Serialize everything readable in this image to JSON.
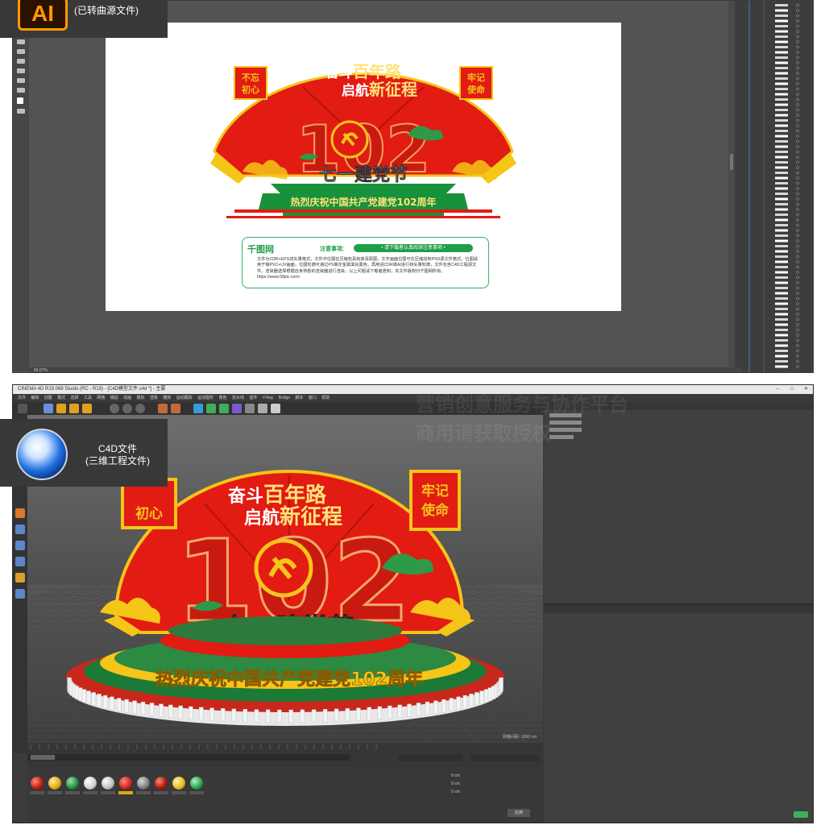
{
  "ai_badge": {
    "logo_text": "AI",
    "caption": "(已转曲源文件)"
  },
  "c4d_badge": {
    "title": "C4D文件",
    "subtitle": "(三维工程文件)"
  },
  "artwork": {
    "slogan_line1_a": "奋斗",
    "slogan_line1_b": "百年路",
    "slogan_line2_a": "启航",
    "slogan_line2_b": "新征程",
    "left_tag": "不忘初心",
    "right_tag": "牢记使命",
    "number": "102",
    "festival": "七一建党节",
    "banner": "热烈庆祝中国共产党建党102周年"
  },
  "notice": {
    "brand": "千图网",
    "title": "注意事项:",
    "pill": "• 请下载者认真阅读注意事项 •",
    "body": "文件为CDR+EPS双矢量格式，文件中位图在压缩包具有高清原图，文字画面位图可在压缩找到PSD源文件格式，位图适用于做PVC+UV画面，位图轮廓可通过PS做定金属填充黑色，再用进CDR或AI进行转矢量轮廓，文件包含C4D工程源文件，渲染器选择根据自身熟悉的渲染器进行渲染，以上问题请下载者悉知，本文件版权归千图网所有，https://www.58pic.com/"
  },
  "c4d": {
    "window_title": "CINEMA 4D R19.068 Studio (RC - R19) - [C4D模型文件.c4d *] - 主要",
    "menu": "文件 编辑 创建 模式 选择 工具 网格 捕捉 动画 模拟 渲染 雕刻 运动跟踪 运动图形 角色 流水线 插件 V-Ray Bridge 脚本 窗口 帮助",
    "ai_status": "66.67%",
    "coords_x": "0 cm",
    "coords_y": "0 cm",
    "coords_z": "0 cm",
    "apply_button": "应用",
    "viewport_label": "网格间距: 1000 cm"
  },
  "watermark": {
    "line1": "营销创意服务与协作平台",
    "line2": "商用请获取授权"
  },
  "colors": {
    "red": "#e21b13",
    "gold": "#f5c518",
    "green": "#17913a",
    "dark_red": "#b3140d"
  }
}
